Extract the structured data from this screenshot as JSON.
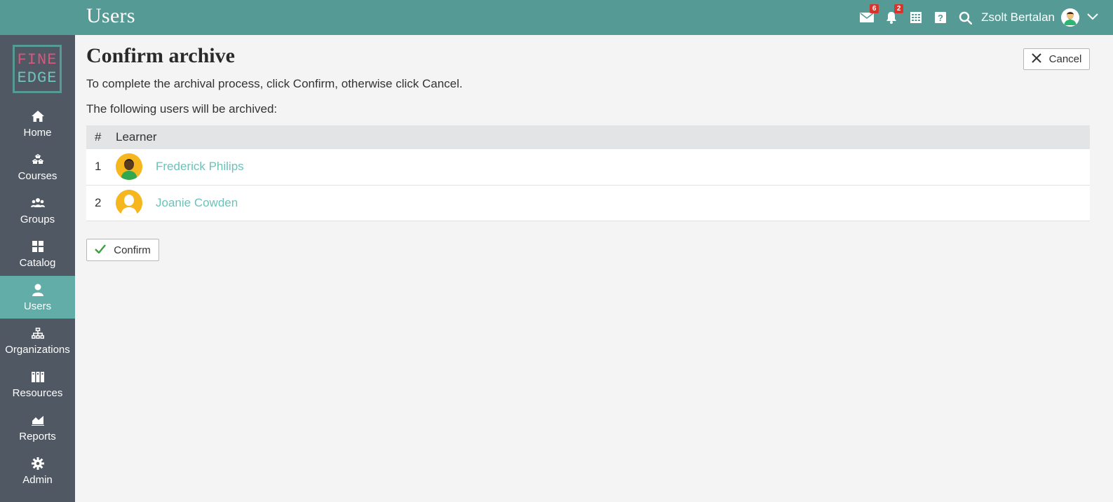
{
  "header": {
    "page_heading": "Users",
    "messages_badge": "6",
    "notifications_badge": "2",
    "user_name": "Zsolt Bertalan"
  },
  "logo": {
    "line1": "FINE",
    "line2": "EDGE"
  },
  "sidebar": {
    "items": [
      {
        "label": "Home",
        "icon": "home-icon"
      },
      {
        "label": "Courses",
        "icon": "courses-icon"
      },
      {
        "label": "Groups",
        "icon": "groups-icon"
      },
      {
        "label": "Catalog",
        "icon": "catalog-icon"
      },
      {
        "label": "Users",
        "icon": "user-icon",
        "active": true
      },
      {
        "label": "Organizations",
        "icon": "organizations-icon"
      },
      {
        "label": "Resources",
        "icon": "resources-icon"
      },
      {
        "label": "Reports",
        "icon": "reports-icon"
      },
      {
        "label": "Admin",
        "icon": "gear-icon"
      }
    ]
  },
  "main": {
    "title": "Confirm archive",
    "cancel_label": "Cancel",
    "description": "To complete the archival process, click Confirm, otherwise click Cancel.",
    "list_intro": "The following users will be archived:",
    "table": {
      "columns": [
        "#",
        "Learner"
      ],
      "rows": [
        {
          "num": "1",
          "name": "Frederick Philips"
        },
        {
          "num": "2",
          "name": "Joanie Cowden"
        }
      ]
    },
    "confirm_label": "Confirm"
  },
  "colors": {
    "header_bg": "#559a95",
    "sidebar_bg": "#505863",
    "sidebar_active": "#62ada7",
    "link": "#6ec1b9",
    "badge": "#d9342b",
    "confirm_check": "#3aa33a"
  }
}
